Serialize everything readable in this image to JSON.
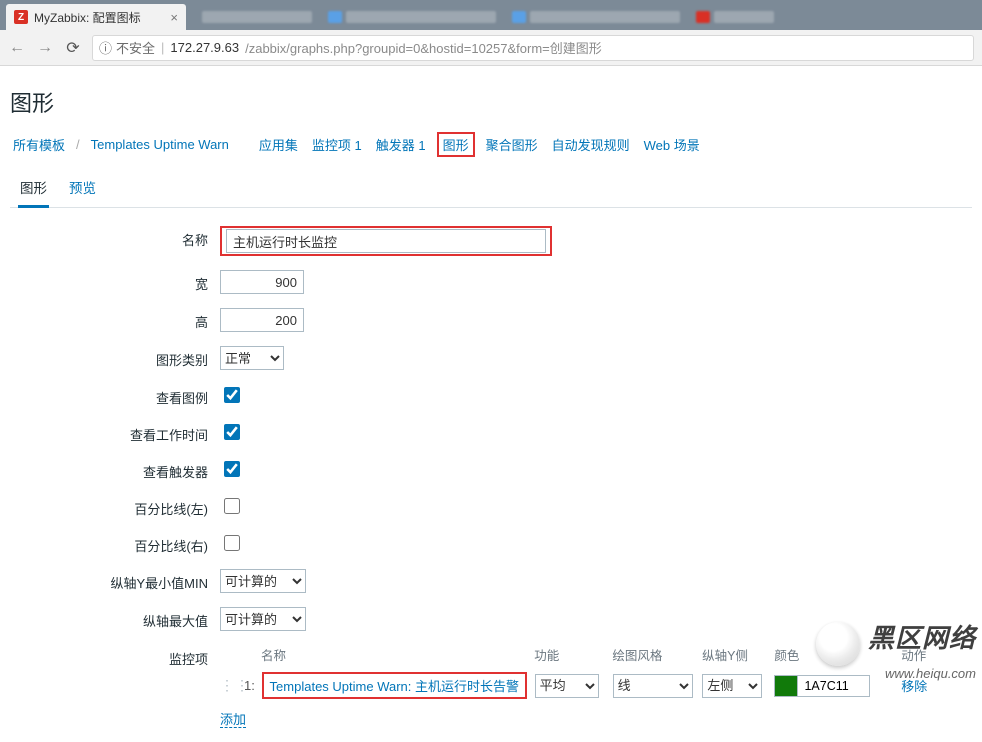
{
  "browser": {
    "tab_title": "MyZabbix: 配置图标",
    "insecure_label": "不安全",
    "url_host": "172.27.9.63",
    "url_path": "/zabbix/graphs.php?groupid=0&hostid=10257&form=创建图形"
  },
  "page_title": "图形",
  "breadcrumb": {
    "all_templates": "所有模板",
    "template_name": "Templates Uptime Warn",
    "apps": "应用集",
    "items": "监控项 1",
    "triggers": "触发器 1",
    "graphs": "图形",
    "aggregate": "聚合图形",
    "discovery": "自动发现规则",
    "web": "Web 场景"
  },
  "tabs": {
    "graph": "图形",
    "preview": "预览"
  },
  "form": {
    "labels": {
      "name": "名称",
      "width": "宽",
      "height": "高",
      "graph_type": "图形类别",
      "show_legend": "查看图例",
      "show_work": "查看工作时间",
      "show_triggers": "查看触发器",
      "pct_left": "百分比线(左)",
      "pct_right": "百分比线(右)",
      "y_min": "纵轴Y最小值MIN",
      "y_max": "纵轴最大值",
      "items": "监控项"
    },
    "values": {
      "name": "主机运行时长监控",
      "width": "900",
      "height": "200",
      "graph_type": "正常",
      "show_legend": true,
      "show_work": true,
      "show_triggers": true,
      "pct_left": false,
      "pct_right": false,
      "y_min": "可计算的",
      "y_max": "可计算的"
    }
  },
  "items_table": {
    "headers": {
      "name": "名称",
      "func": "功能",
      "style": "绘图风格",
      "axis": "纵轴Y侧",
      "color": "颜色",
      "action": "动作"
    },
    "row": {
      "index": "1:",
      "name": "Templates Uptime Warn: 主机运行时长告警",
      "func": "平均",
      "style": "线",
      "axis": "左侧",
      "color_hex": "1A7C11",
      "color_swatch": "#117a0a",
      "remove": "移除"
    },
    "add": "添加"
  },
  "watermark": {
    "big": "黑区网络",
    "small": "www.heiqu.com"
  }
}
